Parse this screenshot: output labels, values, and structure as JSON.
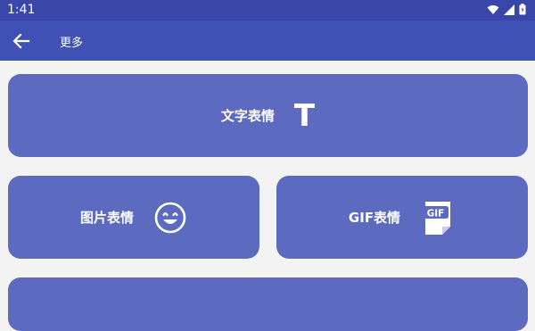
{
  "status_bar": {
    "time": "1:41",
    "icons": [
      "wifi-icon",
      "signal-icon",
      "battery-icon"
    ]
  },
  "app_bar": {
    "back_icon": "arrow-left-icon",
    "title": "更多"
  },
  "cards": {
    "text_emoji": {
      "label": "文字表情",
      "icon": "letter-t-icon",
      "glyph": "T"
    },
    "image_emoji": {
      "label": "图片表情",
      "icon": "smiley-face-icon"
    },
    "gif_emoji": {
      "label": "GIF表情",
      "icon": "gif-file-icon",
      "badge": "GIF"
    }
  },
  "colors": {
    "status_bar": "#3a47a8",
    "app_bar": "#3f51b5",
    "card": "#5c6bc0",
    "background": "#f3f3f3"
  }
}
